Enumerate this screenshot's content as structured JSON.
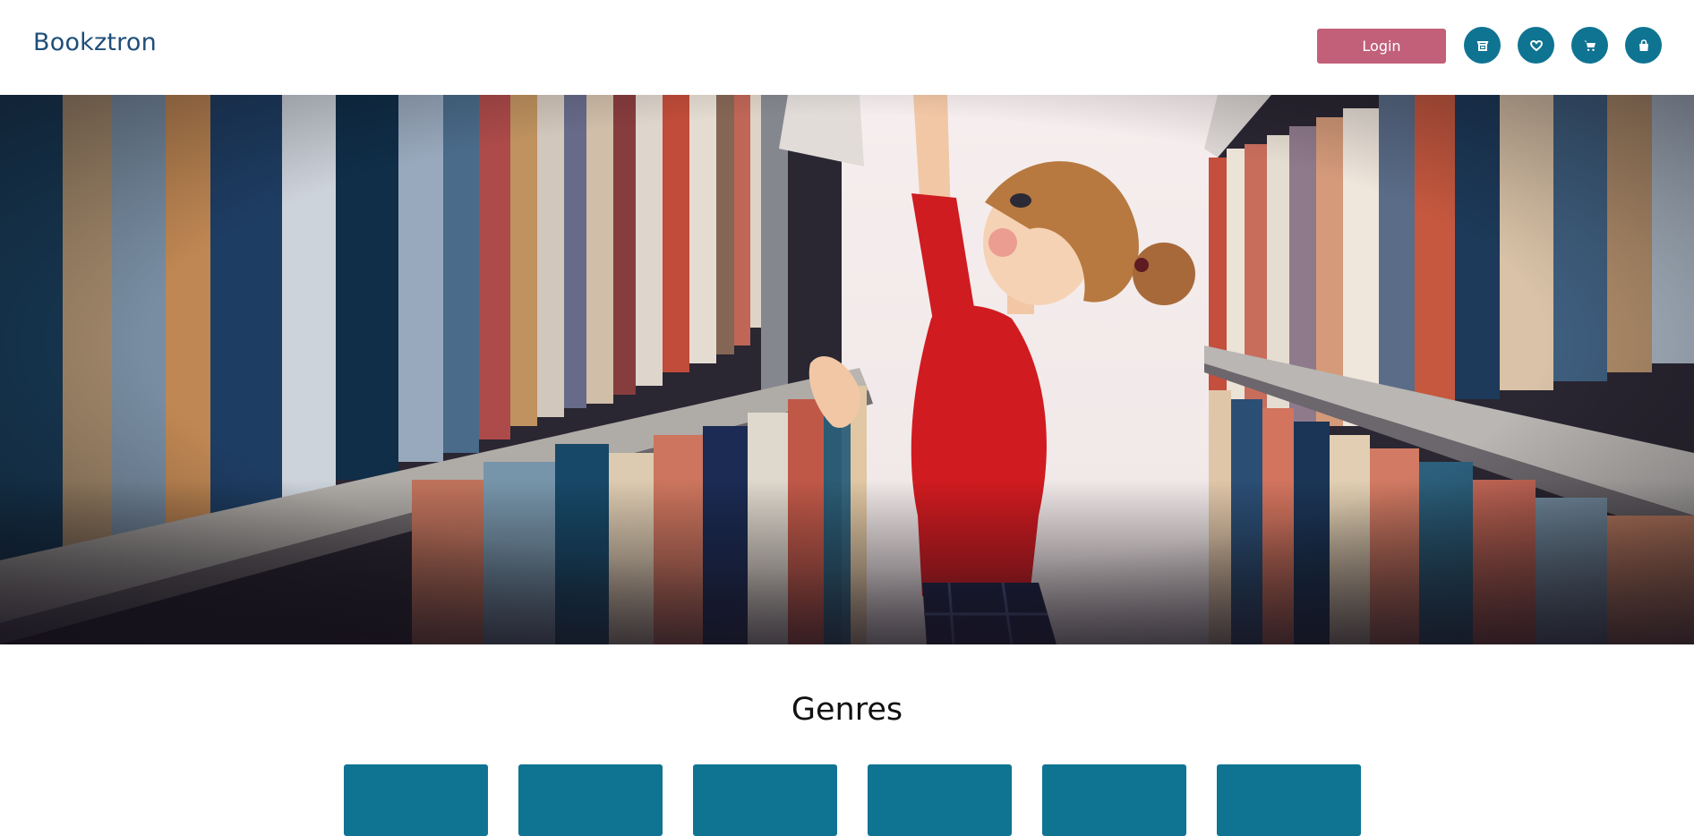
{
  "header": {
    "logo": "Bookztron",
    "login_label": "Login",
    "icons": [
      "store-icon",
      "heart-icon",
      "cart-icon",
      "bag-icon"
    ]
  },
  "hero": {
    "image": "illustration of a girl in a red top reaching for a book between library shelves"
  },
  "genres": {
    "title": "Genres",
    "cards": [
      {},
      {},
      {},
      {},
      {},
      {}
    ]
  },
  "colors": {
    "accent": "#0f7492",
    "login": "#c2607a",
    "logo": "#1f4e79"
  }
}
